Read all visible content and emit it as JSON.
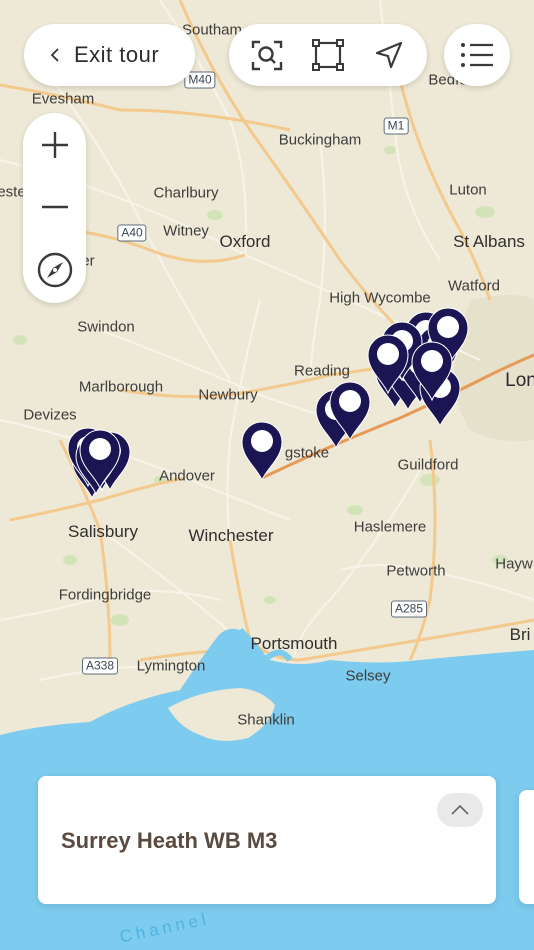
{
  "controls": {
    "exit_tour_label": "Exit tour"
  },
  "map": {
    "places": [
      {
        "id": "southam",
        "name": "Southam"
      },
      {
        "id": "evesham",
        "name": "Evesham"
      },
      {
        "id": "bedford",
        "name": "Bedfo"
      },
      {
        "id": "buckingham",
        "name": "Buckingham"
      },
      {
        "id": "charlbury",
        "name": "Charlbury"
      },
      {
        "id": "luton",
        "name": "Luton"
      },
      {
        "id": "witney",
        "name": "Witney"
      },
      {
        "id": "oxford",
        "name": "Oxford"
      },
      {
        "id": "stalbans",
        "name": "St Albans"
      },
      {
        "id": "cirencester",
        "name": "ester"
      },
      {
        "id": "cer",
        "name": "er"
      },
      {
        "id": "watford",
        "name": "Watford"
      },
      {
        "id": "highwycombe",
        "name": "High Wycombe"
      },
      {
        "id": "swindon",
        "name": "Swindon"
      },
      {
        "id": "reading",
        "name": "Reading"
      },
      {
        "id": "london",
        "name": "Lon"
      },
      {
        "id": "marlborough",
        "name": "Marlborough"
      },
      {
        "id": "newbury",
        "name": "Newbury"
      },
      {
        "id": "devizes",
        "name": "Devizes"
      },
      {
        "id": "basingstoke",
        "name": "gstoke"
      },
      {
        "id": "guildford",
        "name": "Guildford"
      },
      {
        "id": "andover",
        "name": "Andover"
      },
      {
        "id": "salisbury",
        "name": "Salisbury"
      },
      {
        "id": "winchester",
        "name": "Winchester"
      },
      {
        "id": "haslemere",
        "name": "Haslemere"
      },
      {
        "id": "haywards",
        "name": "Hayw"
      },
      {
        "id": "petworth",
        "name": "Petworth"
      },
      {
        "id": "fordingbridge",
        "name": "Fordingbridge"
      },
      {
        "id": "brighton",
        "name": "Bri"
      },
      {
        "id": "portsmouth",
        "name": "Portsmouth"
      },
      {
        "id": "lymington",
        "name": "Lymington"
      },
      {
        "id": "selsey",
        "name": "Selsey"
      },
      {
        "id": "shanklin",
        "name": "Shanklin"
      }
    ],
    "roads": [
      "M40",
      "M1",
      "A40",
      "A338",
      "A285"
    ],
    "sea_label": "Channel"
  },
  "card": {
    "title": "Surrey Heath WB M3"
  },
  "colors": {
    "land": "#eee9d6",
    "sea": "#7dcbee",
    "pin": "#1c1554",
    "card_title": "#5b4a3f"
  }
}
